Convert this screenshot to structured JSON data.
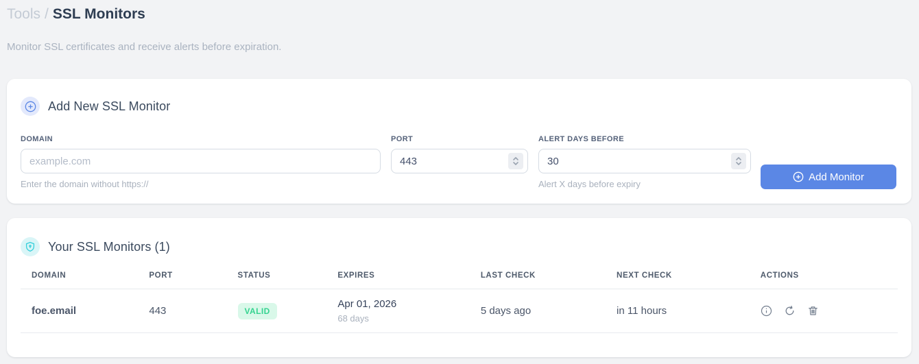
{
  "breadcrumb": {
    "parent": "Tools",
    "separator": "/",
    "current": "SSL Monitors"
  },
  "subtitle": "Monitor SSL certificates and receive alerts before expiration.",
  "add_form": {
    "title": "Add New SSL Monitor",
    "fields": {
      "domain": {
        "label": "DOMAIN",
        "value": "",
        "placeholder": "example.com",
        "hint": "Enter the domain without https://"
      },
      "port": {
        "label": "PORT",
        "value": "443"
      },
      "alert_days": {
        "label": "ALERT DAYS BEFORE",
        "value": "30",
        "hint": "Alert X days before expiry"
      }
    },
    "submit_label": "Add Monitor"
  },
  "monitors": {
    "title": "Your SSL Monitors (1)",
    "count": "1",
    "table": {
      "headers": [
        "DOMAIN",
        "PORT",
        "STATUS",
        "EXPIRES",
        "LAST CHECK",
        "NEXT CHECK",
        "ACTIONS"
      ],
      "rows": [
        {
          "domain": "foe.email",
          "port": "443",
          "status": "VALID",
          "expires_date": "Apr 01, 2026",
          "expires_days": "68 days",
          "last_check": "5 days ago",
          "next_check": "in 11 hours"
        }
      ]
    }
  },
  "icons": {
    "add_badge": "plus-circle-icon",
    "monitors_badge": "shield-icon",
    "submit": "plus-circle-icon",
    "row_actions": [
      "info-icon",
      "refresh-icon",
      "trash-icon"
    ]
  },
  "colors": {
    "page_background": "#f2f3f5",
    "accent_blue": "#5b87e5",
    "accent_cyan": "#35cfdb",
    "valid_badge_bg": "#d9f8e9",
    "valid_badge_text": "#35d390",
    "heading_text": "#2e3d52",
    "muted_text": "#aab3c0"
  }
}
